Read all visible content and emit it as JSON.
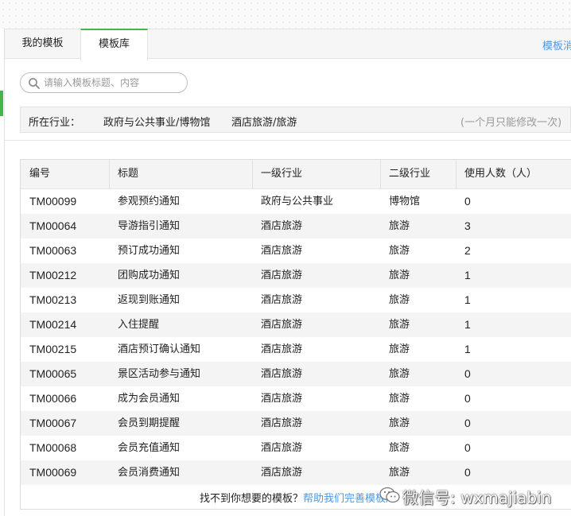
{
  "tabs": {
    "mine": "我的模板",
    "library": "模板库",
    "right_link": "模板消息"
  },
  "search": {
    "placeholder": "请输入模板标题、内容"
  },
  "industry": {
    "label": "所在行业：",
    "primary": "政府与公共事业/博物馆",
    "secondary": "酒店旅游/旅游",
    "note": "(一个月只能修改一次)"
  },
  "table": {
    "headers": {
      "id": "编号",
      "title": "标题",
      "industry1": "一级行业",
      "industry2": "二级行业",
      "users": "使用人数（人）"
    },
    "rows": [
      {
        "id": "TM00099",
        "title": "参观预约通知",
        "industry1": "政府与公共事业",
        "industry2": "博物馆",
        "users": "0"
      },
      {
        "id": "TM00064",
        "title": "导游指引通知",
        "industry1": "酒店旅游",
        "industry2": "旅游",
        "users": "3"
      },
      {
        "id": "TM00063",
        "title": "预订成功通知",
        "industry1": "酒店旅游",
        "industry2": "旅游",
        "users": "2"
      },
      {
        "id": "TM00212",
        "title": "团购成功通知",
        "industry1": "酒店旅游",
        "industry2": "旅游",
        "users": "1"
      },
      {
        "id": "TM00213",
        "title": "返现到账通知",
        "industry1": "酒店旅游",
        "industry2": "旅游",
        "users": "1"
      },
      {
        "id": "TM00214",
        "title": "入住提醒",
        "industry1": "酒店旅游",
        "industry2": "旅游",
        "users": "1"
      },
      {
        "id": "TM00215",
        "title": "酒店预订确认通知",
        "industry1": "酒店旅游",
        "industry2": "旅游",
        "users": "1"
      },
      {
        "id": "TM00065",
        "title": "景区活动参与通知",
        "industry1": "酒店旅游",
        "industry2": "旅游",
        "users": "0"
      },
      {
        "id": "TM00066",
        "title": "成为会员通知",
        "industry1": "酒店旅游",
        "industry2": "旅游",
        "users": "0"
      },
      {
        "id": "TM00067",
        "title": "会员到期提醒",
        "industry1": "酒店旅游",
        "industry2": "旅游",
        "users": "0"
      },
      {
        "id": "TM00068",
        "title": "会员充值通知",
        "industry1": "酒店旅游",
        "industry2": "旅游",
        "users": "0"
      },
      {
        "id": "TM00069",
        "title": "会员消费通知",
        "industry1": "酒店旅游",
        "industry2": "旅游",
        "users": "0"
      }
    ]
  },
  "footer": {
    "text": "找不到你想要的模板？",
    "link": "帮助我们完善模板库"
  },
  "watermark": {
    "text": "微信号: wxmajiabin"
  },
  "colors": {
    "accent_green": "#44b549",
    "link_blue": "#459ae9"
  }
}
